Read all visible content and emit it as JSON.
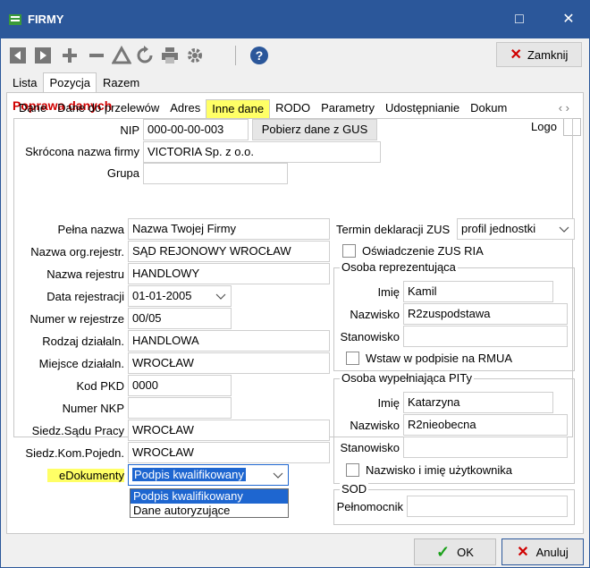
{
  "window": {
    "title": "FIRMY",
    "minimize": "□",
    "close": "✕"
  },
  "toolbar": {
    "close_label": "Zamknij"
  },
  "main_tabs": [
    "Lista",
    "Pozycja",
    "Razem"
  ],
  "panel": {
    "title": "Poprawa danych",
    "logo_label": "Logo",
    "nip_label": "NIP",
    "nip_value": "000-00-00-003",
    "gus_button": "Pobierz dane z GUS",
    "short_name_label": "Skrócona nazwa firmy",
    "short_name_value": "VICTORIA Sp. z o.o.",
    "group_label": "Grupa",
    "group_value": ""
  },
  "sub_tabs": [
    "Dane",
    "Dane do przelewów",
    "Adres",
    "Inne dane",
    "RODO",
    "Parametry",
    "Udostępnianie",
    "Dokum"
  ],
  "left_fields": [
    {
      "label": "Pełna nazwa",
      "value": "Nazwa Twojej Firmy"
    },
    {
      "label": "Nazwa org.rejestr.",
      "value": "SĄD REJONOWY WROCŁAW"
    },
    {
      "label": "Nazwa rejestru",
      "value": "HANDLOWY"
    },
    {
      "label": "Data rejestracji",
      "value": "01-01-2005"
    },
    {
      "label": "Numer w rejestrze",
      "value": "00/05"
    },
    {
      "label": "Rodzaj działaln.",
      "value": "HANDLOWA"
    },
    {
      "label": "Miejsce działaln.",
      "value": "WROCŁAW"
    },
    {
      "label": "Kod PKD",
      "value": "0000"
    },
    {
      "label": "Numer NKP",
      "value": ""
    },
    {
      "label": "Siedz.Sądu Pracy",
      "value": "WROCŁAW"
    },
    {
      "label": "Siedz.Kom.Pojedn.",
      "value": "WROCŁAW"
    },
    {
      "label": "eDokumenty",
      "value": "Podpis kwalifikowany"
    }
  ],
  "dropdown_options": [
    "Podpis kwalifikowany",
    "Dane autoryzujące"
  ],
  "right": {
    "zus_label": "Termin deklaracji ZUS",
    "zus_value": "profil jednostki",
    "zus_ria_label": "Oświadczenie ZUS RIA",
    "rep_group": "Osoba reprezentująca",
    "rep_first_label": "Imię",
    "rep_first_value": "Kamil",
    "rep_last_label": "Nazwisko",
    "rep_last_value": "R2zuspodstawa",
    "rep_position_label": "Stanowisko",
    "rep_position_value": "",
    "rep_insert_label": "Wstaw w podpisie na RMUA",
    "pit_group": "Osoba wypełniająca PITy",
    "pit_first_label": "Imię",
    "pit_first_value": "Katarzyna",
    "pit_last_label": "Nazwisko",
    "pit_last_value": "R2nieobecna",
    "pit_position_label": "Stanowisko",
    "pit_position_value": "",
    "pit_user_label": "Nazwisko i imię użytkownika",
    "sod_group": "SOD",
    "sod_label": "Pełnomocnik",
    "sod_value": ""
  },
  "footer": {
    "ok": "OK",
    "cancel": "Anuluj"
  },
  "colors": {
    "titlebar": "#2b579a",
    "accent_red": "#d00000",
    "highlight": "#ffff66",
    "selection": "#1e66d0"
  }
}
